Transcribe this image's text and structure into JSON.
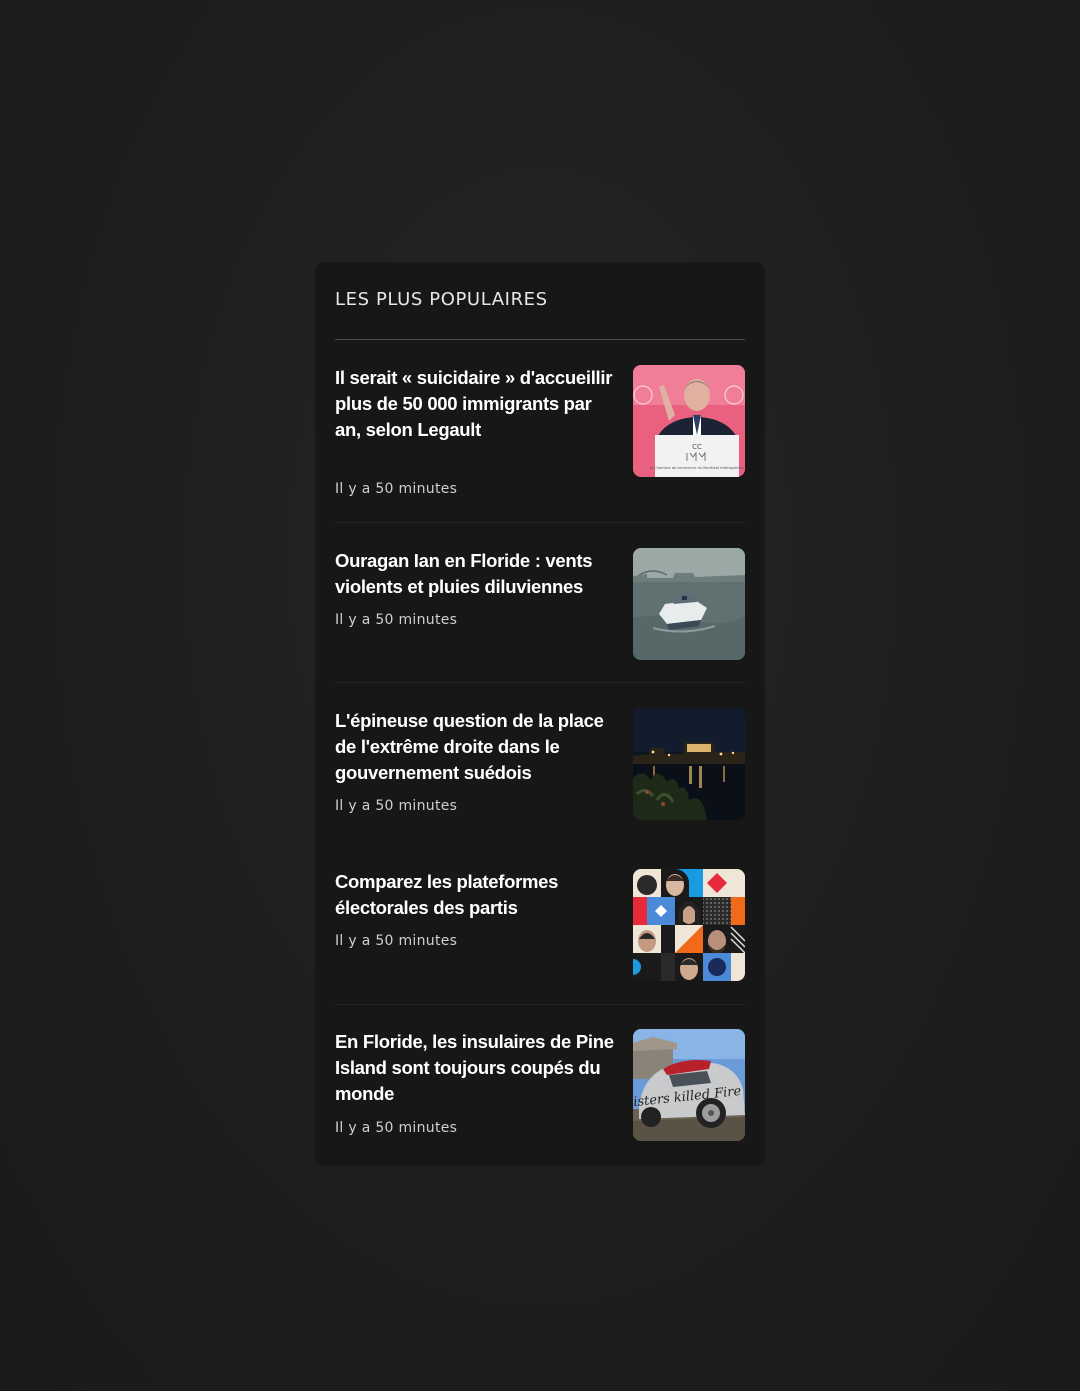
{
  "widget": {
    "title": "LES PLUS POPULAIRES",
    "articles": [
      {
        "headline": "Il serait « suicidaire » d'accueillir plus de 50 000 immigrants par an, selon Legault",
        "time": "Il y a 50 minutes",
        "thumbnail_icon": "politician-podium-photo",
        "podium_text": "la Chambre de commerce du Montréal métropolitain"
      },
      {
        "headline": "Ouragan Ian en Floride : vents violents et pluies diluviennes",
        "time": "Il y a 50 minutes",
        "thumbnail_icon": "flooded-boat-photo"
      },
      {
        "headline": "L'épineuse question de la place de l'extrême droite dans le gouvernement suédois",
        "time": "Il y a 50 minutes",
        "thumbnail_icon": "night-city-river-photo"
      },
      {
        "headline": "Comparez les plateformes électorales des partis",
        "time": "Il y a 50 minutes",
        "thumbnail_icon": "candidates-mosaic-illustration"
      },
      {
        "headline": "En Floride, les insulaires de Pine Island sont toujours coupés du monde",
        "time": "Il y a 50 minutes",
        "thumbnail_icon": "damaged-car-photo",
        "graffiti_text": "Sisters killed Fire"
      }
    ]
  },
  "colors": {
    "page_background": "#1e1e1e",
    "card_background": "#171717",
    "headline": "#ffffff",
    "meta": "#cfcfcf"
  }
}
